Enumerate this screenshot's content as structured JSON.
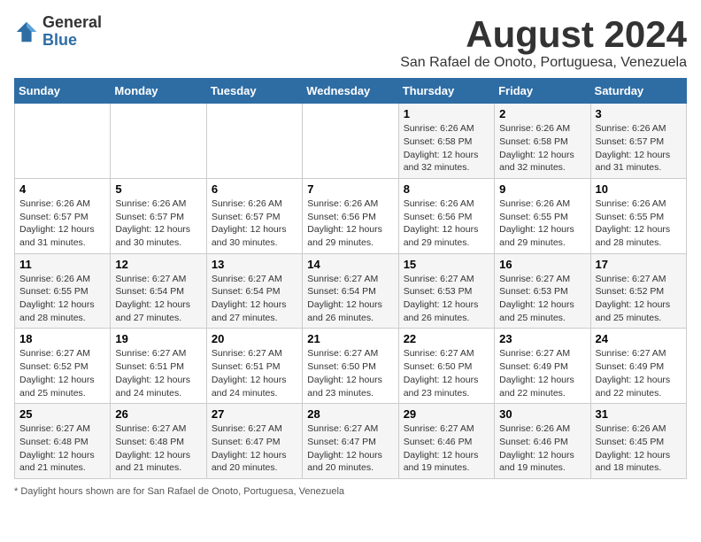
{
  "logo": {
    "general": "General",
    "blue": "Blue"
  },
  "title": "August 2024",
  "subtitle": "San Rafael de Onoto, Portuguesa, Venezuela",
  "days_of_week": [
    "Sunday",
    "Monday",
    "Tuesday",
    "Wednesday",
    "Thursday",
    "Friday",
    "Saturday"
  ],
  "weeks": [
    [
      {
        "day": "",
        "info": ""
      },
      {
        "day": "",
        "info": ""
      },
      {
        "day": "",
        "info": ""
      },
      {
        "day": "",
        "info": ""
      },
      {
        "day": "1",
        "info": "Sunrise: 6:26 AM\nSunset: 6:58 PM\nDaylight: 12 hours\nand 32 minutes."
      },
      {
        "day": "2",
        "info": "Sunrise: 6:26 AM\nSunset: 6:58 PM\nDaylight: 12 hours\nand 32 minutes."
      },
      {
        "day": "3",
        "info": "Sunrise: 6:26 AM\nSunset: 6:57 PM\nDaylight: 12 hours\nand 31 minutes."
      }
    ],
    [
      {
        "day": "4",
        "info": "Sunrise: 6:26 AM\nSunset: 6:57 PM\nDaylight: 12 hours\nand 31 minutes."
      },
      {
        "day": "5",
        "info": "Sunrise: 6:26 AM\nSunset: 6:57 PM\nDaylight: 12 hours\nand 30 minutes."
      },
      {
        "day": "6",
        "info": "Sunrise: 6:26 AM\nSunset: 6:57 PM\nDaylight: 12 hours\nand 30 minutes."
      },
      {
        "day": "7",
        "info": "Sunrise: 6:26 AM\nSunset: 6:56 PM\nDaylight: 12 hours\nand 29 minutes."
      },
      {
        "day": "8",
        "info": "Sunrise: 6:26 AM\nSunset: 6:56 PM\nDaylight: 12 hours\nand 29 minutes."
      },
      {
        "day": "9",
        "info": "Sunrise: 6:26 AM\nSunset: 6:55 PM\nDaylight: 12 hours\nand 29 minutes."
      },
      {
        "day": "10",
        "info": "Sunrise: 6:26 AM\nSunset: 6:55 PM\nDaylight: 12 hours\nand 28 minutes."
      }
    ],
    [
      {
        "day": "11",
        "info": "Sunrise: 6:26 AM\nSunset: 6:55 PM\nDaylight: 12 hours\nand 28 minutes."
      },
      {
        "day": "12",
        "info": "Sunrise: 6:27 AM\nSunset: 6:54 PM\nDaylight: 12 hours\nand 27 minutes."
      },
      {
        "day": "13",
        "info": "Sunrise: 6:27 AM\nSunset: 6:54 PM\nDaylight: 12 hours\nand 27 minutes."
      },
      {
        "day": "14",
        "info": "Sunrise: 6:27 AM\nSunset: 6:54 PM\nDaylight: 12 hours\nand 26 minutes."
      },
      {
        "day": "15",
        "info": "Sunrise: 6:27 AM\nSunset: 6:53 PM\nDaylight: 12 hours\nand 26 minutes."
      },
      {
        "day": "16",
        "info": "Sunrise: 6:27 AM\nSunset: 6:53 PM\nDaylight: 12 hours\nand 25 minutes."
      },
      {
        "day": "17",
        "info": "Sunrise: 6:27 AM\nSunset: 6:52 PM\nDaylight: 12 hours\nand 25 minutes."
      }
    ],
    [
      {
        "day": "18",
        "info": "Sunrise: 6:27 AM\nSunset: 6:52 PM\nDaylight: 12 hours\nand 25 minutes."
      },
      {
        "day": "19",
        "info": "Sunrise: 6:27 AM\nSunset: 6:51 PM\nDaylight: 12 hours\nand 24 minutes."
      },
      {
        "day": "20",
        "info": "Sunrise: 6:27 AM\nSunset: 6:51 PM\nDaylight: 12 hours\nand 24 minutes."
      },
      {
        "day": "21",
        "info": "Sunrise: 6:27 AM\nSunset: 6:50 PM\nDaylight: 12 hours\nand 23 minutes."
      },
      {
        "day": "22",
        "info": "Sunrise: 6:27 AM\nSunset: 6:50 PM\nDaylight: 12 hours\nand 23 minutes."
      },
      {
        "day": "23",
        "info": "Sunrise: 6:27 AM\nSunset: 6:49 PM\nDaylight: 12 hours\nand 22 minutes."
      },
      {
        "day": "24",
        "info": "Sunrise: 6:27 AM\nSunset: 6:49 PM\nDaylight: 12 hours\nand 22 minutes."
      }
    ],
    [
      {
        "day": "25",
        "info": "Sunrise: 6:27 AM\nSunset: 6:48 PM\nDaylight: 12 hours\nand 21 minutes."
      },
      {
        "day": "26",
        "info": "Sunrise: 6:27 AM\nSunset: 6:48 PM\nDaylight: 12 hours\nand 21 minutes."
      },
      {
        "day": "27",
        "info": "Sunrise: 6:27 AM\nSunset: 6:47 PM\nDaylight: 12 hours\nand 20 minutes."
      },
      {
        "day": "28",
        "info": "Sunrise: 6:27 AM\nSunset: 6:47 PM\nDaylight: 12 hours\nand 20 minutes."
      },
      {
        "day": "29",
        "info": "Sunrise: 6:27 AM\nSunset: 6:46 PM\nDaylight: 12 hours\nand 19 minutes."
      },
      {
        "day": "30",
        "info": "Sunrise: 6:26 AM\nSunset: 6:46 PM\nDaylight: 12 hours\nand 19 minutes."
      },
      {
        "day": "31",
        "info": "Sunrise: 6:26 AM\nSunset: 6:45 PM\nDaylight: 12 hours\nand 18 minutes."
      }
    ]
  ],
  "footer": "Daylight hours"
}
